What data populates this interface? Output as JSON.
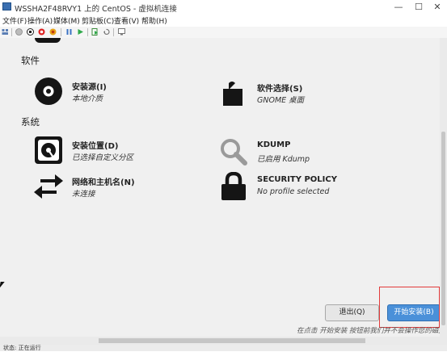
{
  "window": {
    "title": "WSSHA2F48RVY1 上的 CentOS - 虚拟机连接",
    "min_glyph": "—",
    "max_glyph": "☐",
    "close_glyph": "✕"
  },
  "menu": {
    "items": [
      "文件(F)",
      "操作(A)",
      "媒体(M)",
      "剪贴板(C)",
      "查看(V)",
      "帮助(H)"
    ]
  },
  "toolbar": {
    "icons": [
      "ctrl-alt-del-icon",
      "start-icon",
      "turn-off-icon",
      "shutdown-icon",
      "power-icon",
      "pause-icon",
      "resume-icon",
      "checkpoint-icon",
      "revert-icon",
      "enhanced-session-icon"
    ]
  },
  "installer": {
    "sections": {
      "software": "软件",
      "system": "系统"
    },
    "spokes": {
      "install_source": {
        "name": "安装源(I)",
        "status": "本地介质"
      },
      "software_selection": {
        "name": "软件选择(S)",
        "status": "GNOME 桌面"
      },
      "install_destination": {
        "name": "安装位置(D)",
        "status": "已选择自定义分区"
      },
      "kdump": {
        "name": "KDUMP",
        "status": "已启用 Kdump"
      },
      "network": {
        "name": "网络和主机名(N)",
        "status": "未连接"
      },
      "security": {
        "name": "SECURITY POLICY",
        "status": "No profile selected"
      }
    },
    "buttons": {
      "quit": "退出(Q)",
      "begin": "开始安装(B)"
    },
    "hint": "在点击 开始安装 按钮前我们并不会操作您的磁盘。"
  },
  "statusbar": {
    "text": "状态: 正在运行"
  },
  "colors": {
    "accent": "#4a90d9",
    "highlight": "#e23a3a",
    "content_bg": "#f0f0f0"
  }
}
